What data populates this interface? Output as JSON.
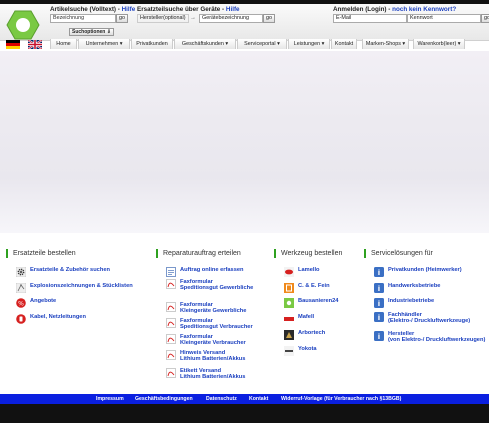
{
  "header": {
    "artikelsuche": {
      "title": "Artikelsuche (Volltext)",
      "sep": " - ",
      "help": "Hilfe",
      "field": "Bezeichnung",
      "go": "go",
      "suchoptionen": "Suchoptionen ⇓"
    },
    "ersatzteilsuche": {
      "title": "Ersatzteilsuche über Geräte",
      "sep": " - ",
      "help": "Hilfe",
      "field1": "Hersteller(optional)",
      "arrow": "→",
      "field2": "Gerätebezeichnung",
      "go": "go"
    },
    "login": {
      "title": "Anmelden (Login)",
      "sep": " - ",
      "link": "noch kein Kennwort?",
      "email": "E-Mail",
      "password": "Kennwort",
      "go": "go"
    }
  },
  "nav": {
    "tabs": [
      "Home",
      "Unternehmen ▾",
      "Privatkunden",
      "Geschäftskunden ▾",
      "Serviceportal ▾",
      "Leistungen ▾",
      "Kontakt",
      "Marken-Shops ▾",
      "Warenkorb(leer) ▾"
    ]
  },
  "columns": {
    "ersatzteile": {
      "heading": "Ersatzteile bestellen",
      "items": [
        "Ersatzteile & Zubehör suchen",
        "Explosionszeichnungen & Stücklisten",
        "Angebote",
        "Kabel, Netzleitungen"
      ]
    },
    "reparatur": {
      "heading": "Reparaturauftrag erteilen",
      "items": [
        {
          "l1": "Auftrag online erfassen",
          "l2": ""
        },
        {
          "l1": "Faxformular",
          "l2": "Speditionsgut Gewerbliche"
        },
        {
          "l1": "Faxformular",
          "l2": "Kleingeräte Gewerbliche"
        },
        {
          "l1": "Faxformular",
          "l2": "Speditionsgut Verbraucher"
        },
        {
          "l1": "Faxformular",
          "l2": "Kleingeräte Verbraucher"
        },
        {
          "l1": "Hinweis Versand",
          "l2": "Lithium Batterien/Akkus"
        },
        {
          "l1": "Etikett Versand",
          "l2": "Lithium Batterien/Akkus"
        }
      ]
    },
    "werkzeug": {
      "heading": "Werkzeug bestellen",
      "items": [
        "Lamello",
        "C. & E. Fein",
        "Bausanieren24",
        "Mafell",
        "Arbortech",
        "Yokota"
      ]
    },
    "service": {
      "heading": "Servicelösungen für",
      "items": [
        {
          "l1": "Privatkunden (Heimwerker)",
          "l2": ""
        },
        {
          "l1": "Handwerksbetriebe",
          "l2": ""
        },
        {
          "l1": "Industriebetriebe",
          "l2": ""
        },
        {
          "l1": "Fachhändler",
          "l2": "(Elektro-/ Druckluftwerkzeuge)"
        },
        {
          "l1": "Hersteller",
          "l2": "(von Elektro-/ Druckluftwerkzeugen)"
        }
      ]
    }
  },
  "footer": {
    "links": [
      "Impressum",
      "Geschäftsbedingungen",
      "Datenschutz",
      "Kontakt",
      "Widerruf-Vorlage (für Verbraucher nach §13BGB)"
    ]
  },
  "colors": {
    "accent_green": "#2fa11f",
    "link_blue": "#1a3fbf",
    "footer_blue": "#0a1fe0"
  }
}
